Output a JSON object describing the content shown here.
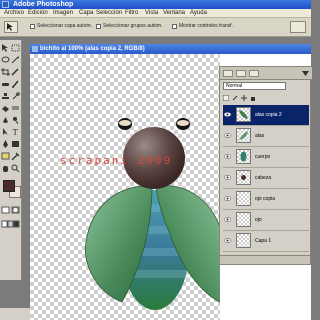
{
  "app": {
    "title": "Adobe Photoshop"
  },
  "menu": [
    "Archivo",
    "Edición",
    "Imagen",
    "Capa",
    "Selección",
    "Filtro",
    "Vista",
    "Ventana",
    "Ayuda"
  ],
  "options": {
    "auto_select_layer": "Seleccionar capa autom.",
    "auto_select_group": "Seleccionar grupos autom.",
    "show_transform": "Mostrar controles transf."
  },
  "document": {
    "title": "bichito al 100% (alas copia 2, RGB/8)",
    "watermark": "scrapani 2009"
  },
  "layers": {
    "blend_mode": "Normal",
    "items": [
      {
        "name": "alas copia 2",
        "selected": true
      },
      {
        "name": "alas",
        "selected": false
      },
      {
        "name": "cuerpo",
        "selected": false
      },
      {
        "name": "cabeza",
        "selected": false
      },
      {
        "name": "ojo copia",
        "selected": false
      },
      {
        "name": "ojo",
        "selected": false
      },
      {
        "name": "Capa 1",
        "selected": false
      }
    ]
  },
  "colors": {
    "titlebar": "#2a5bc9",
    "selection": "#0a246a",
    "watermark": "#d24a3c",
    "foreground": "#4a2a2a",
    "background": "#f4e4e0"
  }
}
